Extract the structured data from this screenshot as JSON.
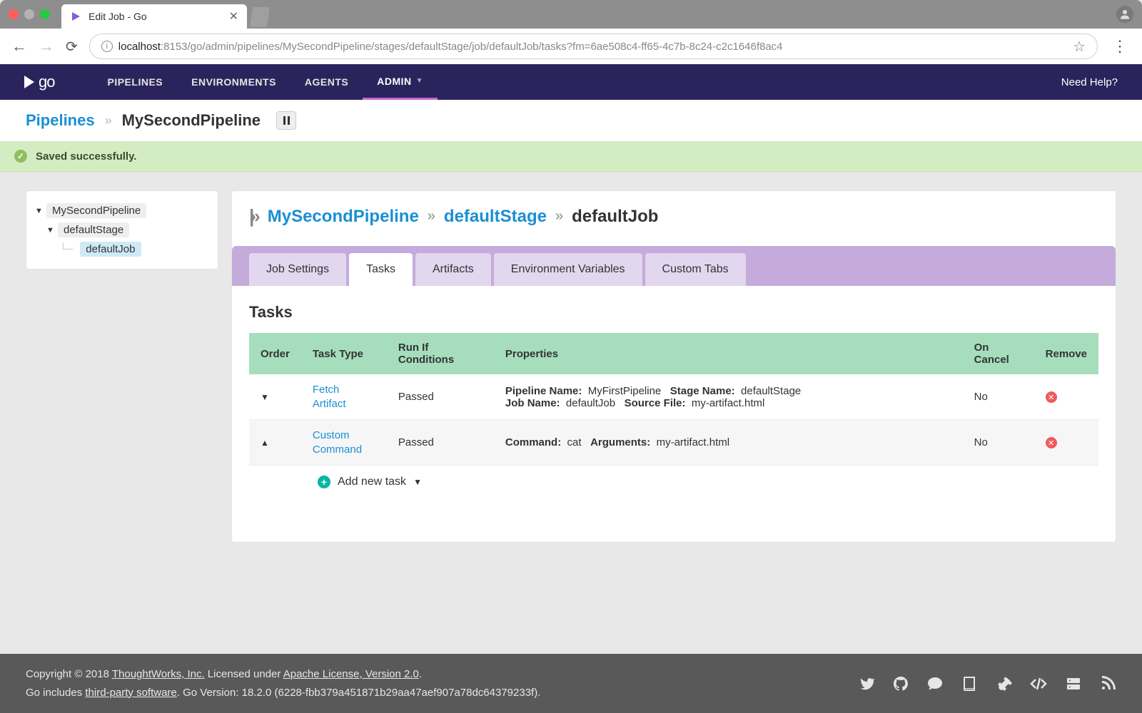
{
  "browser": {
    "tab_title": "Edit Job - Go",
    "url_host": "localhost",
    "url_rest": ":8153/go/admin/pipelines/MySecondPipeline/stages/defaultStage/job/defaultJob/tasks?fm=6ae508c4-ff65-4c7b-8c24-c2c1646f8ac4"
  },
  "app_nav": {
    "items": [
      "PIPELINES",
      "ENVIRONMENTS",
      "AGENTS",
      "ADMIN"
    ],
    "active": "ADMIN",
    "help": "Need Help?"
  },
  "breadcrumb1": {
    "link": "Pipelines",
    "current": "MySecondPipeline"
  },
  "flash": "Saved successfully.",
  "tree": {
    "pipeline": "MySecondPipeline",
    "stage": "defaultStage",
    "job": "defaultJob"
  },
  "breadcrumb2": {
    "pipeline": "MySecondPipeline",
    "stage": "defaultStage",
    "job": "defaultJob"
  },
  "tabs": [
    "Job Settings",
    "Tasks",
    "Artifacts",
    "Environment Variables",
    "Custom Tabs"
  ],
  "active_tab": "Tasks",
  "section_title": "Tasks",
  "table": {
    "headers": [
      "Order",
      "Task Type",
      "Run If Conditions",
      "Properties",
      "On Cancel",
      "Remove"
    ],
    "rows": [
      {
        "order_dir": "down",
        "type": "Fetch Artifact",
        "runif": "Passed",
        "props": [
          {
            "k": "Pipeline Name:",
            "v": "MyFirstPipeline"
          },
          {
            "k": "Stage Name:",
            "v": "defaultStage"
          },
          {
            "k": "Job Name:",
            "v": "defaultJob"
          },
          {
            "k": "Source File:",
            "v": "my-artifact.html"
          }
        ],
        "on_cancel": "No"
      },
      {
        "order_dir": "up",
        "type": "Custom Command",
        "runif": "Passed",
        "props": [
          {
            "k": "Command:",
            "v": "cat"
          },
          {
            "k": "Arguments:",
            "v": "my-artifact.html"
          }
        ],
        "on_cancel": "No"
      }
    ],
    "add_label": "Add new task"
  },
  "footer": {
    "line1_pre": "Copyright © 2018 ",
    "tw": "ThoughtWorks, Inc.",
    "line1_mid": " Licensed under ",
    "license": "Apache License, Version 2.0",
    "line1_post": ".",
    "line2_pre": "Go includes ",
    "tps": "third-party software",
    "line2_post": ". Go Version: 18.2.0 (6228-fbb379a451871b29aa47aef907a78dc64379233f)."
  }
}
